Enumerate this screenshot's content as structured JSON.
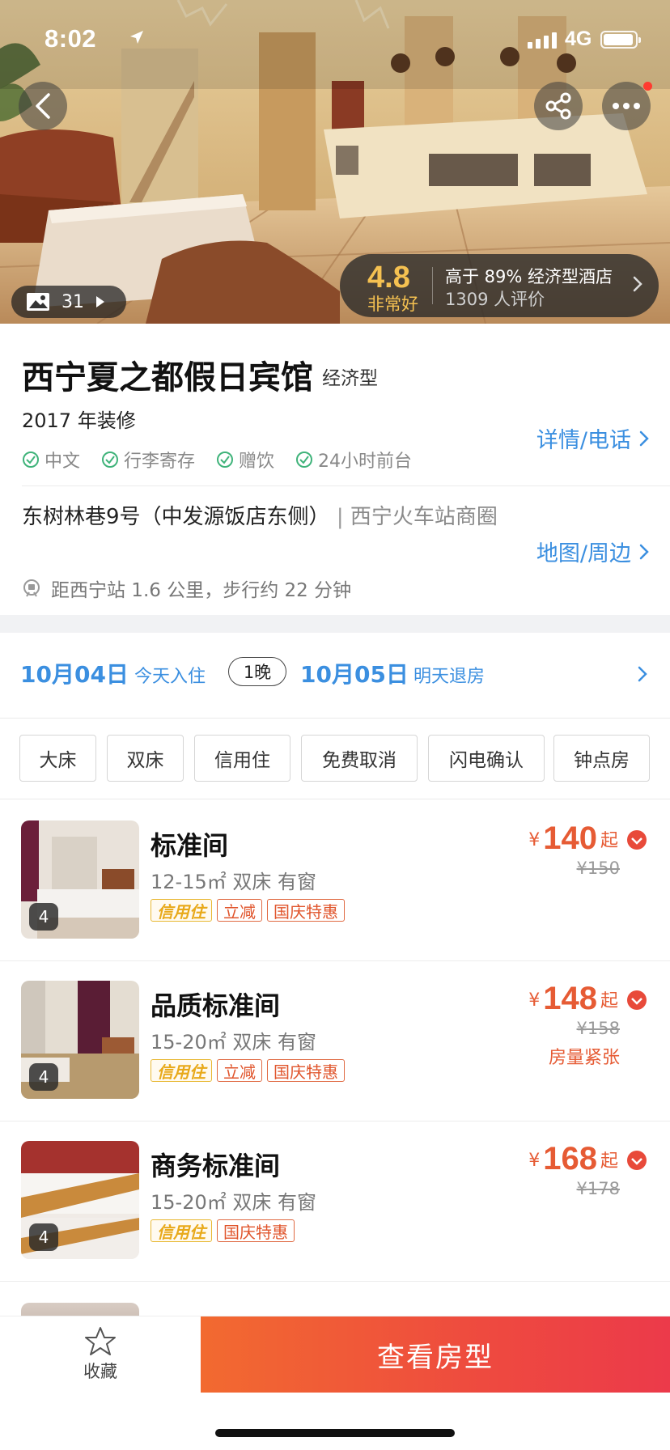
{
  "status_bar": {
    "time": "8:02",
    "network": "4G"
  },
  "gallery": {
    "count": "31"
  },
  "rating": {
    "score": "4.8",
    "word": "非常好",
    "rank_text": "高于 89% 经济型酒店",
    "review_count": "1309 人评价"
  },
  "hotel": {
    "name": "西宁夏之都假日宾馆",
    "type": "经济型",
    "renovated": "2017 年装修",
    "amenities": [
      "中文",
      "行李寄存",
      "赠饮",
      "24小时前台"
    ],
    "detail_link": "详情/电话",
    "address": "东树林巷9号（中发源饭店东侧）",
    "separator": "|",
    "district": "西宁火车站商圈",
    "map_link": "地图/周边",
    "distance": "距西宁站 1.6 公里，步行约 22 分钟"
  },
  "dates": {
    "check_in": "10月04日",
    "check_in_label": "今天入住",
    "nights": "1晚",
    "check_out": "10月05日",
    "check_out_label": "明天退房"
  },
  "filters": [
    "大床",
    "双床",
    "信用住",
    "免费取消",
    "闪电确认",
    "钟点房"
  ],
  "rooms": [
    {
      "name": "标准间",
      "spec": "12-15㎡ 双床 有窗",
      "photos": "4",
      "tags": [
        "信用住",
        "立减",
        "国庆特惠"
      ],
      "currency": "¥",
      "price": "140",
      "from": "起",
      "orig_price": "¥150",
      "note": ""
    },
    {
      "name": "品质标准间",
      "spec": "15-20㎡ 双床 有窗",
      "photos": "4",
      "tags": [
        "信用住",
        "立减",
        "国庆特惠"
      ],
      "currency": "¥",
      "price": "148",
      "from": "起",
      "orig_price": "¥158",
      "note": "房量紧张"
    },
    {
      "name": "商务标准间",
      "spec": "15-20㎡ 双床 有窗",
      "photos": "4",
      "tags": [
        "信用住",
        "国庆特惠"
      ],
      "currency": "¥",
      "price": "168",
      "from": "起",
      "orig_price": "¥178",
      "note": ""
    }
  ],
  "bottom_bar": {
    "favorite_label": "收藏",
    "cta_label": "查看房型"
  },
  "colors": {
    "accent_blue": "#3b8fe0",
    "price_red": "#e65b34",
    "rating_gold": "#f5c151",
    "credit_yellow": "#e8a91a"
  },
  "icons": {
    "back": "chevron-left-icon",
    "share": "share-icon",
    "more": "more-icon",
    "gallery": "image-icon",
    "check": "check-circle-icon",
    "metro": "metro-icon",
    "star": "star-icon",
    "chevron": "chevron-right-icon"
  }
}
